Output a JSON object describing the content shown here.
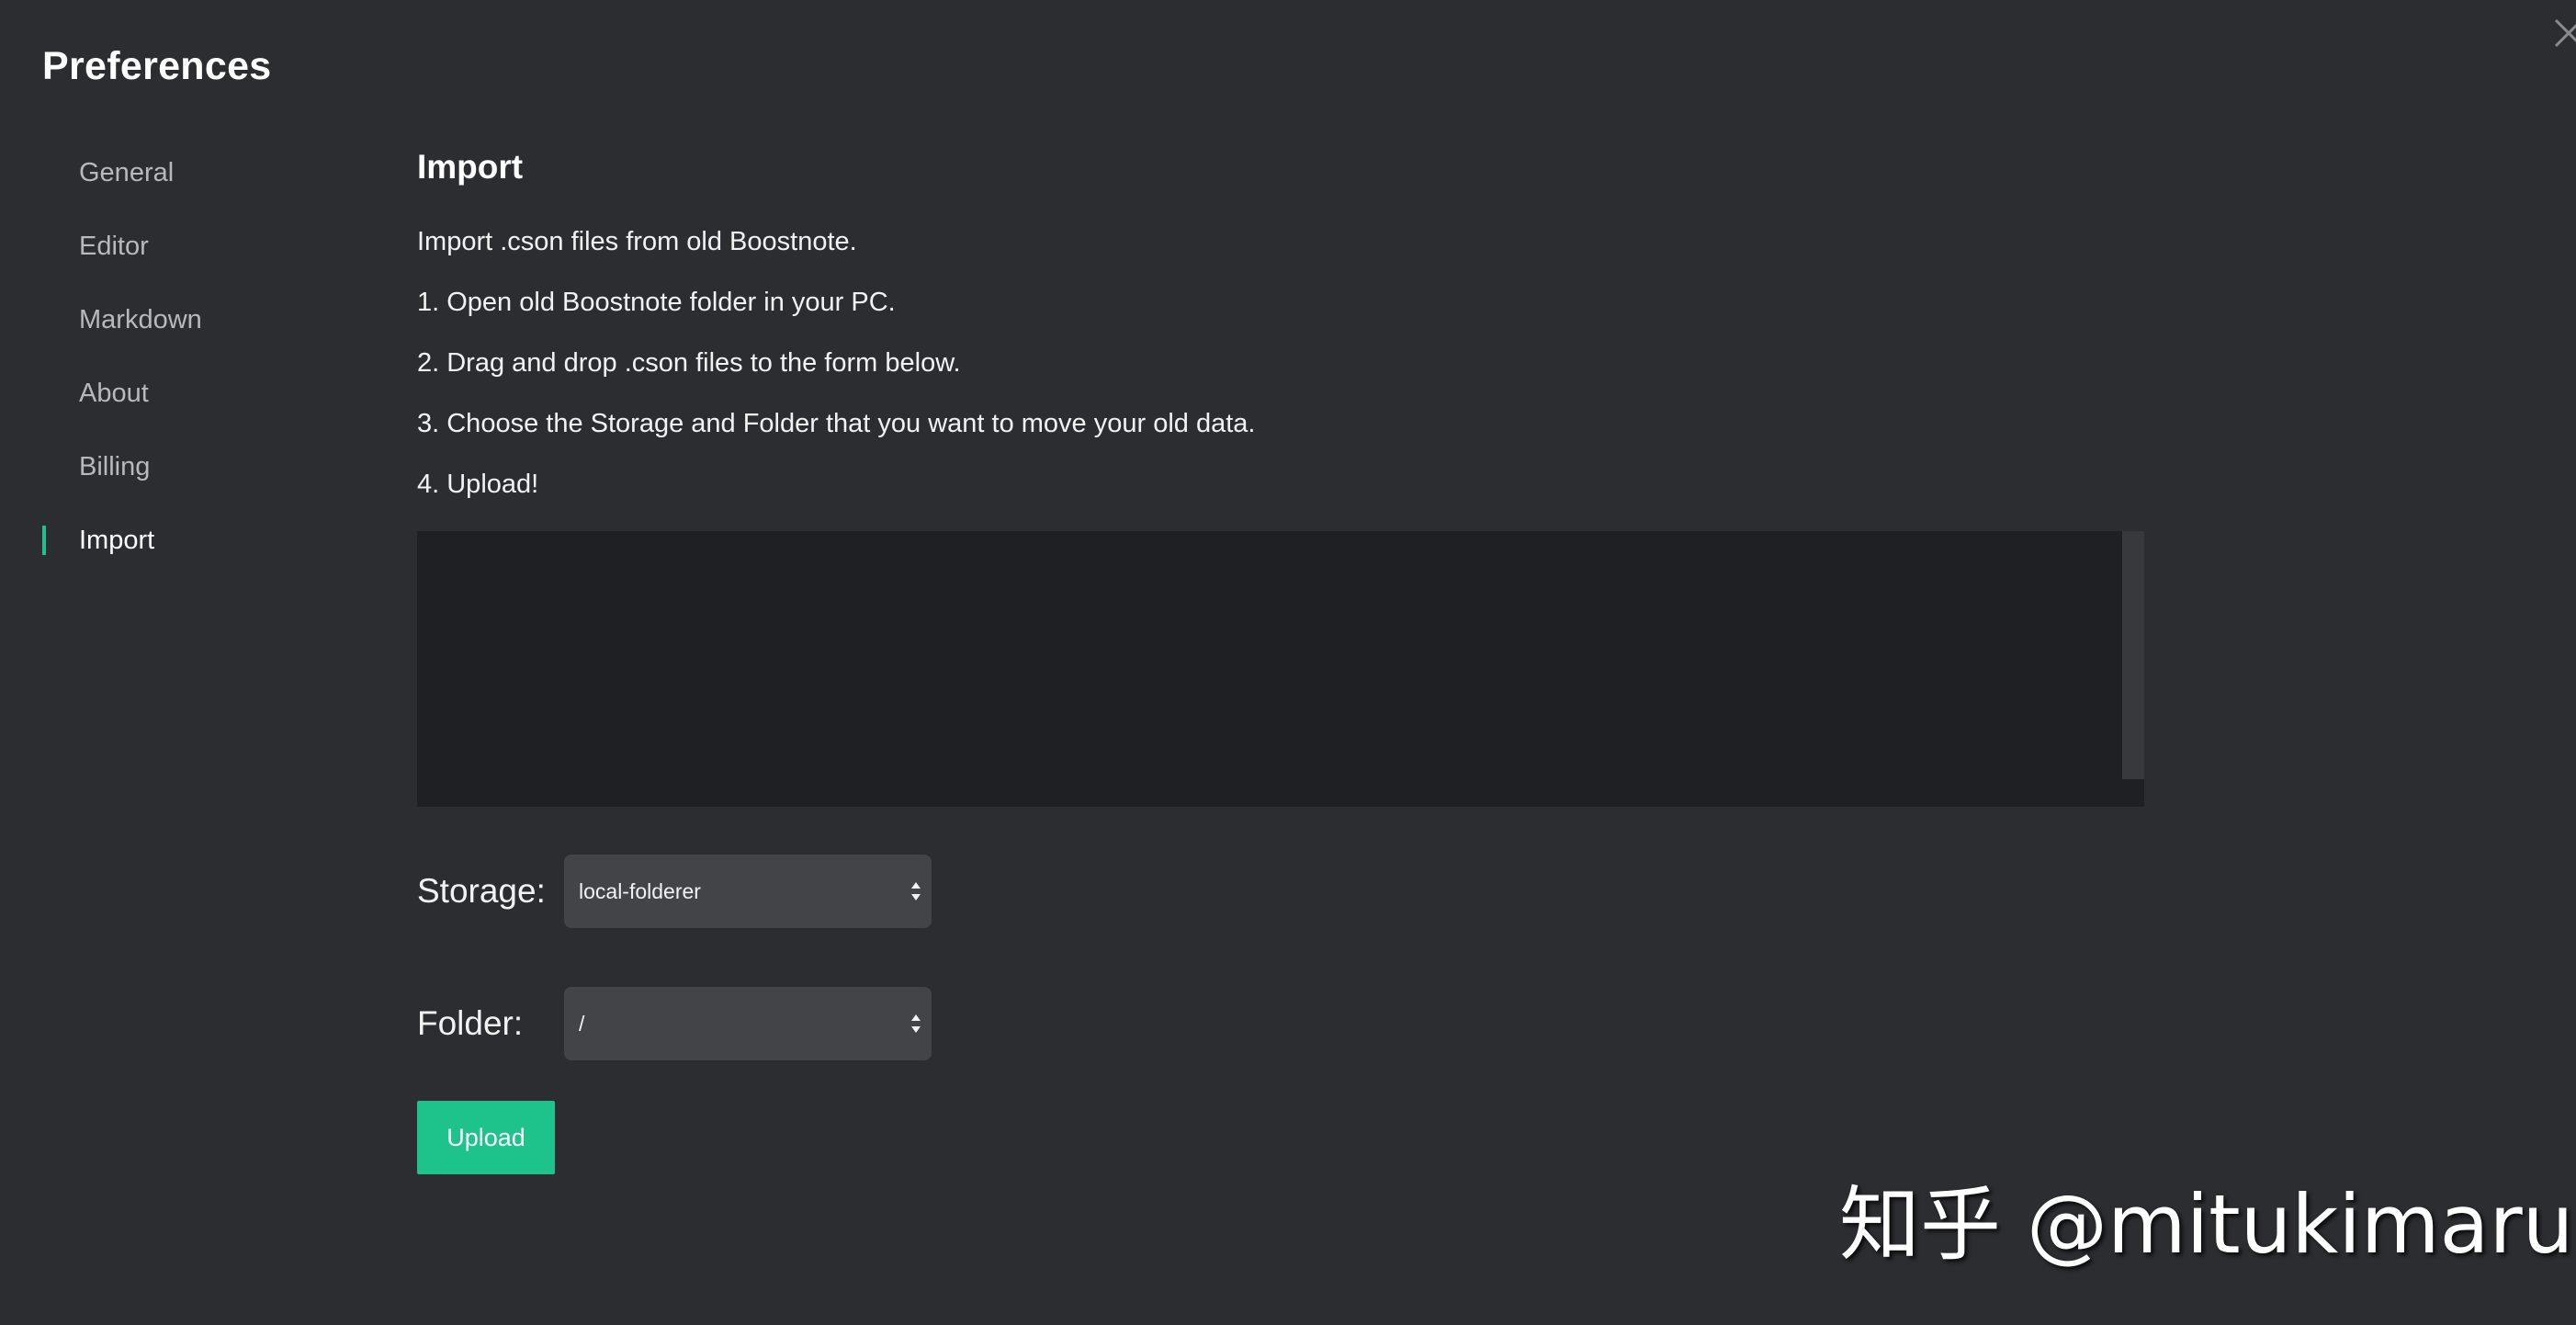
{
  "app": {
    "title": "Preferences"
  },
  "sidebar": {
    "items": [
      {
        "label": "General"
      },
      {
        "label": "Editor"
      },
      {
        "label": "Markdown"
      },
      {
        "label": "About"
      },
      {
        "label": "Billing"
      },
      {
        "label": "Import",
        "active": true
      }
    ],
    "active_indicator_color": "#1ec38b"
  },
  "import": {
    "title": "Import",
    "intro": "Import .cson files from old Boostnote.",
    "steps": [
      "1. Open old Boostnote folder in your PC.",
      "2. Drag and drop .cson files to the form below.",
      "3. Choose the Storage and Folder that you want to move your old data.",
      "4. Upload!"
    ],
    "storage": {
      "label": "Storage:",
      "value": "local-folderer"
    },
    "folder": {
      "label": "Folder:",
      "value": "/"
    },
    "upload_label": "Upload",
    "upload_color": "#1ec38b"
  },
  "icons": {
    "close": "close-icon",
    "select_arrows": "select-arrows-icon"
  },
  "watermark": {
    "text": "知乎 @mitukimaru"
  }
}
